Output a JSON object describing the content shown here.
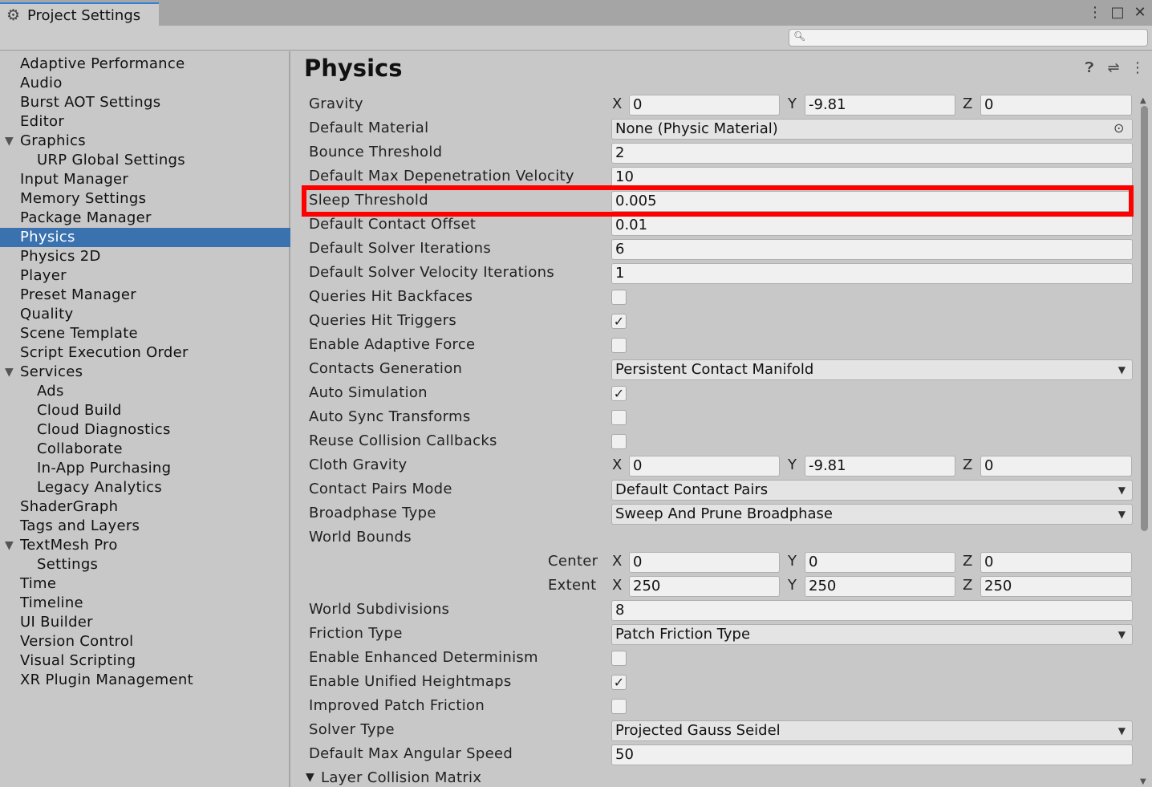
{
  "window": {
    "tab_title": "Project Settings",
    "tab_icon": "gear-icon",
    "controls": [
      "⋮",
      "□",
      "✕"
    ]
  },
  "search": {
    "placeholder": "",
    "value": ""
  },
  "sidebar": {
    "items": [
      {
        "label": "Adaptive Performance",
        "indent": 0
      },
      {
        "label": "Audio",
        "indent": 0
      },
      {
        "label": "Burst AOT Settings",
        "indent": 0
      },
      {
        "label": "Editor",
        "indent": 0
      },
      {
        "label": "Graphics",
        "indent": 0,
        "expanded": true
      },
      {
        "label": "URP Global Settings",
        "indent": 1
      },
      {
        "label": "Input Manager",
        "indent": 0
      },
      {
        "label": "Memory Settings",
        "indent": 0
      },
      {
        "label": "Package Manager",
        "indent": 0
      },
      {
        "label": "Physics",
        "indent": 0,
        "selected": true
      },
      {
        "label": "Physics 2D",
        "indent": 0
      },
      {
        "label": "Player",
        "indent": 0
      },
      {
        "label": "Preset Manager",
        "indent": 0
      },
      {
        "label": "Quality",
        "indent": 0
      },
      {
        "label": "Scene Template",
        "indent": 0
      },
      {
        "label": "Script Execution Order",
        "indent": 0
      },
      {
        "label": "Services",
        "indent": 0,
        "expanded": true
      },
      {
        "label": "Ads",
        "indent": 1
      },
      {
        "label": "Cloud Build",
        "indent": 1
      },
      {
        "label": "Cloud Diagnostics",
        "indent": 1
      },
      {
        "label": "Collaborate",
        "indent": 1
      },
      {
        "label": "In-App Purchasing",
        "indent": 1
      },
      {
        "label": "Legacy Analytics",
        "indent": 1
      },
      {
        "label": "ShaderGraph",
        "indent": 0
      },
      {
        "label": "Tags and Layers",
        "indent": 0
      },
      {
        "label": "TextMesh Pro",
        "indent": 0,
        "expanded": true
      },
      {
        "label": "Settings",
        "indent": 1
      },
      {
        "label": "Time",
        "indent": 0
      },
      {
        "label": "Timeline",
        "indent": 0
      },
      {
        "label": "UI Builder",
        "indent": 0
      },
      {
        "label": "Version Control",
        "indent": 0
      },
      {
        "label": "Visual Scripting",
        "indent": 0
      },
      {
        "label": "XR Plugin Management",
        "indent": 0
      }
    ]
  },
  "main": {
    "title": "Physics",
    "header_icons": [
      "help-icon",
      "preset-icon",
      "more-icon"
    ],
    "gravity": {
      "label": "Gravity",
      "x": "0",
      "y": "-9.81",
      "z": "0"
    },
    "default_material": {
      "label": "Default Material",
      "value": "None (Physic Material)"
    },
    "bounce_threshold": {
      "label": "Bounce Threshold",
      "value": "2"
    },
    "max_depenetration": {
      "label": "Default Max Depenetration Velocity",
      "value": "10"
    },
    "sleep_threshold": {
      "label": "Sleep Threshold",
      "value": "0.005"
    },
    "contact_offset": {
      "label": "Default Contact Offset",
      "value": "0.01"
    },
    "solver_iterations": {
      "label": "Default Solver Iterations",
      "value": "6"
    },
    "solver_velocity_iterations": {
      "label": "Default Solver Velocity Iterations",
      "value": "1"
    },
    "queries_hit_backfaces": {
      "label": "Queries Hit Backfaces",
      "checked": false
    },
    "queries_hit_triggers": {
      "label": "Queries Hit Triggers",
      "checked": true
    },
    "enable_adaptive_force": {
      "label": "Enable Adaptive Force",
      "checked": false
    },
    "contacts_generation": {
      "label": "Contacts Generation",
      "value": "Persistent Contact Manifold"
    },
    "auto_simulation": {
      "label": "Auto Simulation",
      "checked": true
    },
    "auto_sync_transforms": {
      "label": "Auto Sync Transforms",
      "checked": false
    },
    "reuse_collision_callbacks": {
      "label": "Reuse Collision Callbacks",
      "checked": false
    },
    "cloth_gravity": {
      "label": "Cloth Gravity",
      "x": "0",
      "y": "-9.81",
      "z": "0"
    },
    "contact_pairs_mode": {
      "label": "Contact Pairs Mode",
      "value": "Default Contact Pairs"
    },
    "broadphase_type": {
      "label": "Broadphase Type",
      "value": "Sweep And Prune Broadphase"
    },
    "world_bounds": {
      "label": "World Bounds",
      "center_label": "Center",
      "center": {
        "x": "0",
        "y": "0",
        "z": "0"
      },
      "extent_label": "Extent",
      "extent": {
        "x": "250",
        "y": "250",
        "z": "250"
      }
    },
    "world_subdivisions": {
      "label": "World Subdivisions",
      "value": "8"
    },
    "friction_type": {
      "label": "Friction Type",
      "value": "Patch Friction Type"
    },
    "enhanced_determinism": {
      "label": "Enable Enhanced Determinism",
      "checked": false
    },
    "unified_heightmaps": {
      "label": "Enable Unified Heightmaps",
      "checked": true
    },
    "improved_patch_friction": {
      "label": "Improved Patch Friction",
      "checked": false
    },
    "solver_type": {
      "label": "Solver Type",
      "value": "Projected Gauss Seidel"
    },
    "max_angular_speed": {
      "label": "Default Max Angular Speed",
      "value": "50"
    },
    "layer_collision_matrix": {
      "label": "Layer Collision Matrix"
    },
    "axis_labels": {
      "x": "X",
      "y": "Y",
      "z": "Z"
    }
  },
  "colors": {
    "highlight": "#ff0000",
    "selection": "#3a72b0",
    "tab_accent": "#2f7fd6"
  }
}
